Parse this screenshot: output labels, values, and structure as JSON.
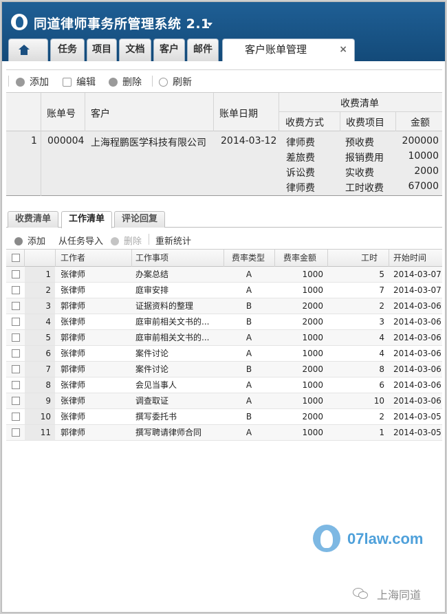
{
  "app": {
    "title": "同道律师事务所管理系统 2.1"
  },
  "nav_tabs": [
    "任务",
    "项目",
    "文档",
    "客户",
    "邮件"
  ],
  "active_tab": {
    "label": "客户账单管理",
    "close": "×"
  },
  "toolbar": {
    "add": "添加",
    "edit": "编辑",
    "delete": "删除",
    "refresh": "刷新"
  },
  "account_grid": {
    "headers": {
      "bill_no": "账单号",
      "client": "客户",
      "bill_date": "账单日期",
      "fee_list": "收费清单",
      "method": "收费方式",
      "item": "收费项目",
      "amount": "金额"
    },
    "row": {
      "index": "1",
      "bill_no": "000004",
      "client": "上海程鹏医学科技有限公司",
      "bill_date": "2014-03-12",
      "fees": [
        {
          "method": "律师费",
          "item": "预收费",
          "amount": "200000"
        },
        {
          "method": "差旅费",
          "item": "报销费用",
          "amount": "10000"
        },
        {
          "method": "诉讼费",
          "item": "实收费",
          "amount": "2000"
        },
        {
          "method": "律师费",
          "item": "工时收费",
          "amount": "67000"
        }
      ]
    }
  },
  "sub_tabs": [
    "收费清单",
    "工作清单",
    "评论回复"
  ],
  "work_toolbar": {
    "add": "添加",
    "import": "从任务导入",
    "delete": "删除",
    "recalc": "重新统计"
  },
  "work_grid": {
    "headers": {
      "worker": "工作者",
      "task": "工作事项",
      "rate_type": "费率类型",
      "rate_amount": "费率金额",
      "hours": "工时",
      "start": "开始时间"
    },
    "rows": [
      {
        "n": "1",
        "worker": "张律师",
        "task": "办案总结",
        "type": "A",
        "rate": "1000",
        "hours": "5",
        "start": "2014-03-07"
      },
      {
        "n": "2",
        "worker": "张律师",
        "task": "庭审安排",
        "type": "A",
        "rate": "1000",
        "hours": "7",
        "start": "2014-03-07"
      },
      {
        "n": "3",
        "worker": "郭律师",
        "task": "证据资料的整理",
        "type": "B",
        "rate": "2000",
        "hours": "2",
        "start": "2014-03-06"
      },
      {
        "n": "4",
        "worker": "张律师",
        "task": "庭审前相关文书的...",
        "type": "B",
        "rate": "2000",
        "hours": "3",
        "start": "2014-03-06"
      },
      {
        "n": "5",
        "worker": "郭律师",
        "task": "庭审前相关文书的...",
        "type": "A",
        "rate": "1000",
        "hours": "4",
        "start": "2014-03-06"
      },
      {
        "n": "6",
        "worker": "张律师",
        "task": "案件讨论",
        "type": "A",
        "rate": "1000",
        "hours": "4",
        "start": "2014-03-06"
      },
      {
        "n": "7",
        "worker": "郭律师",
        "task": "案件讨论",
        "type": "B",
        "rate": "2000",
        "hours": "8",
        "start": "2014-03-06"
      },
      {
        "n": "8",
        "worker": "张律师",
        "task": "会见当事人",
        "type": "A",
        "rate": "1000",
        "hours": "6",
        "start": "2014-03-06"
      },
      {
        "n": "9",
        "worker": "张律师",
        "task": "调查取证",
        "type": "A",
        "rate": "1000",
        "hours": "10",
        "start": "2014-03-06"
      },
      {
        "n": "10",
        "worker": "张律师",
        "task": "撰写委托书",
        "type": "B",
        "rate": "2000",
        "hours": "2",
        "start": "2014-03-05"
      },
      {
        "n": "11",
        "worker": "郭律师",
        "task": "撰写聘请律师合同",
        "type": "A",
        "rate": "1000",
        "hours": "1",
        "start": "2014-03-05"
      }
    ]
  },
  "watermark": {
    "site": "07law.com",
    "wechat": "上海同道"
  }
}
